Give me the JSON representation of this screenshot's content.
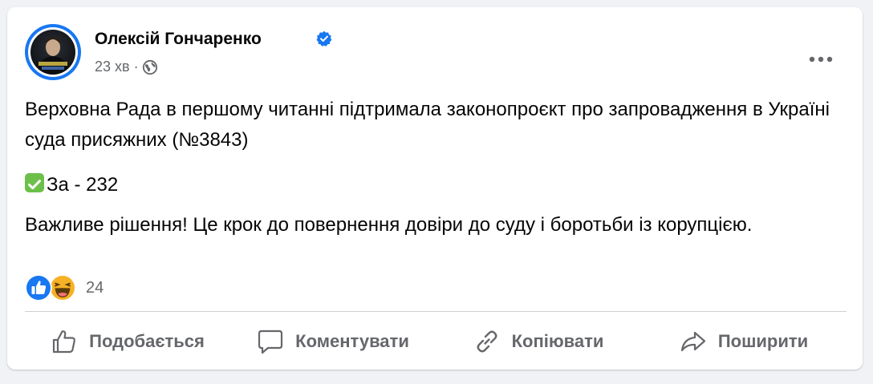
{
  "post": {
    "author": "Олексій Гончаренко",
    "time": "23 хв",
    "separator": "·",
    "text_paragraph_1": "Верховна Рада в першому читанні підтримала законопроєкт про запровадження в Україні суда присяжних (№3843)",
    "vote_line": "За - 232",
    "text_paragraph_3": "Важливе рішення! Це крок до повернення довіри до суду і боротьби із корупцією."
  },
  "reactions": {
    "count": "24",
    "types": [
      "like-icon",
      "haha-icon"
    ]
  },
  "actions": {
    "like": "Подобається",
    "comment": "Коментувати",
    "copy": "Копіювати",
    "share": "Поширити"
  },
  "colors": {
    "brand": "#1877f2",
    "muted": "#65676b",
    "background": "#f0f2f5",
    "check": "#6cc04a"
  }
}
